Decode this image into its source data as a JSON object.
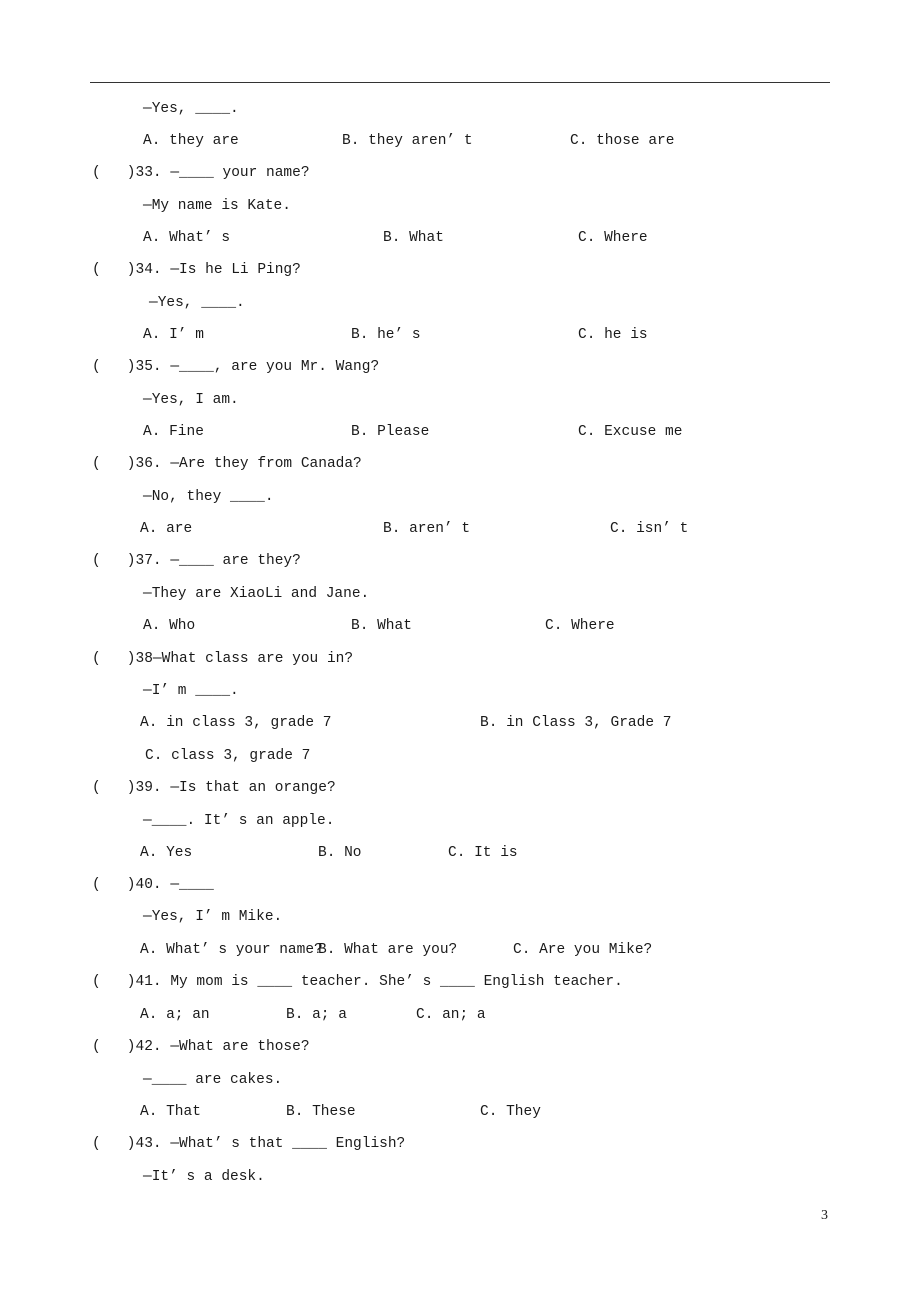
{
  "page_number": "3",
  "lines": {
    "q32_answer": "—Yes, ____.",
    "q32_optA": "A. they are",
    "q32_optB": "B. they aren’ t",
    "q32_optC": "C. those are",
    "q33_q": "(   )33. —____ your name?",
    "q33_answer": "—My name is Kate.",
    "q33_optA": "A. What’ s",
    "q33_optB": "B. What",
    "q33_optC": "C. Where",
    "q34_q": "(   )34. —Is he Li Ping?",
    "q34_answer": "—Yes, ____.",
    "q34_optA": "A. I’ m",
    "q34_optB": "B. he’ s",
    "q34_optC": "C. he is",
    "q35_q": "(   )35. —____, are you Mr. Wang?",
    "q35_answer": "—Yes, I am.",
    "q35_optA": "A. Fine",
    "q35_optB": "B. Please",
    "q35_optC": "C. Excuse me",
    "q36_q": "(   )36. —Are they from Canada?",
    "q36_answer": "—No, they ____.",
    "q36_optA": "A. are",
    "q36_optB": "B. aren’ t",
    "q36_optC": "C. isn’ t",
    "q37_q": "(   )37. —____ are they?",
    "q37_answer": "—They are XiaoLi and Jane.",
    "q37_optA": "A. Who",
    "q37_optB": "B. What",
    "q37_optC": "C. Where",
    "q38_q": "(   )38—What class are you in?",
    "q38_answer": "—I’ m ____.",
    "q38_optA": "A. in class 3, grade 7",
    "q38_optB": "B. in Class 3, Grade 7",
    "q38_optC": "C. class 3, grade 7",
    "q39_q": "(   )39. —Is that an orange?",
    "q39_answer": "—____. It’ s an apple.",
    "q39_optA": "A. Yes",
    "q39_optB": "B. No",
    "q39_optC": "C. It is",
    "q40_q": "(   )40. —____",
    "q40_answer": "—Yes, I’ m Mike.",
    "q40_optA": "A. What’ s your name?",
    "q40_optB": "B. What are you?",
    "q40_optC": "C. Are you Mike?",
    "q41_q": "(   )41. My mom is ____ teacher. She’ s ____ English teacher.",
    "q41_optA": "A. a; an",
    "q41_optB": "B. a; a",
    "q41_optC": "C. an; a",
    "q42_q": "(   )42. —What are those?",
    "q42_answer": "—____ are cakes.",
    "q42_optA": "A. That",
    "q42_optB": "B. These",
    "q42_optC": "C. They",
    "q43_q": "(   )43. —What’ s that ____ English?",
    "q43_answer": "—It’ s a desk."
  }
}
